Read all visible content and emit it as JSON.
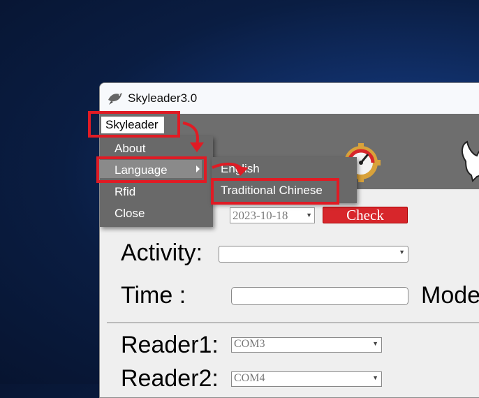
{
  "window": {
    "title": "Skyleader3.0"
  },
  "menubar": {
    "skyleader": "Skyleader"
  },
  "dropdown": {
    "items": [
      {
        "label": "About"
      },
      {
        "label": "Language"
      },
      {
        "label": "Rfid"
      },
      {
        "label": "Close"
      }
    ]
  },
  "language_submenu": {
    "items": [
      {
        "label": "English"
      },
      {
        "label": "Traditional Chinese"
      }
    ]
  },
  "form": {
    "date_value": "2023-10-18",
    "check_label": "Check",
    "activity_label": "Activity:",
    "activity_value": "",
    "time_label": "Time :",
    "time_value": "",
    "mode_label": "Mode",
    "reader1_label": "Reader1:",
    "reader1_value": "COM3",
    "reader2_label": "Reader2:",
    "reader2_value": "COM4"
  },
  "icons": {
    "app": "pigeon-icon",
    "banner_left": "speedometer-gear-icon",
    "banner_right": "pigeon-logo-icon"
  },
  "colors": {
    "annotation": "#e01b24",
    "check_button": "#d7262b",
    "menu_bg": "#696969"
  }
}
